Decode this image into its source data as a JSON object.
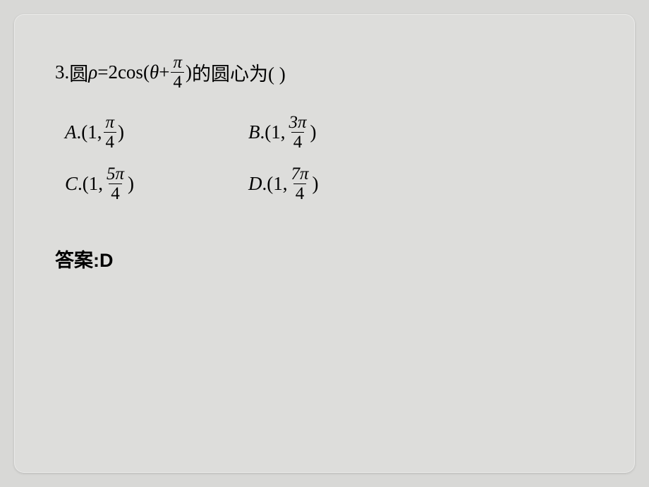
{
  "question": {
    "number": "3.",
    "prefix_cjk": "圆",
    "rho": "ρ",
    "equals": " = ",
    "coeff": "2cos(",
    "theta": "θ",
    "plus": " + ",
    "frac_num": "π",
    "frac_den": "4",
    "close_paren": ")",
    "suffix_cjk": "的圆心为(   )"
  },
  "options": {
    "A": {
      "label": "A",
      "prefix": ".(1,",
      "num": "π",
      "den": "4",
      "suffix": ")"
    },
    "B": {
      "label": "B",
      "prefix": ".(1,",
      "num": "3π",
      "den": "4",
      "suffix": ")"
    },
    "C": {
      "label": "C",
      "prefix": ".(1,",
      "num": "5π",
      "den": "4",
      "suffix": ")"
    },
    "D": {
      "label": "D",
      "prefix": ".(1,",
      "num": "7π",
      "den": "4",
      "suffix": ")"
    }
  },
  "answer": {
    "label": "答案:",
    "value": "D"
  }
}
